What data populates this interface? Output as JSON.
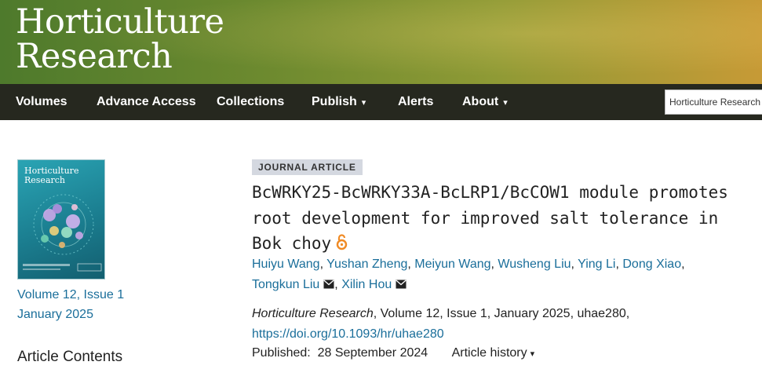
{
  "header": {
    "brand_line1": "Horticulture",
    "brand_line2": "Research"
  },
  "nav": {
    "items": [
      {
        "label": "Volumes"
      },
      {
        "label": "Advance Access"
      },
      {
        "label": "Collections"
      },
      {
        "label": "Publish"
      },
      {
        "label": "Alerts"
      },
      {
        "label": "About"
      }
    ],
    "search_label": "Horticulture Research"
  },
  "sidebar": {
    "cover_title_line1": "Horticulture",
    "cover_title_line2": "Research",
    "volume_issue": "Volume 12, Issue 1",
    "issue_date": "January 2025",
    "contents_heading": "Article Contents"
  },
  "article": {
    "type_badge": "JOURNAL ARTICLE",
    "title_line1": "BcWRKY25-BcWRKY33A-BcLRP1/BcCOW1 module promotes",
    "title_line2": "root development for improved salt tolerance in",
    "title_line3": "Bok choy",
    "authors": [
      "Huiyu Wang",
      "Yushan Zheng",
      "Meiyun Wang",
      "Wusheng Liu",
      "Ying Li",
      "Dong Xiao",
      "Tongkun Liu",
      "Xilin Hou"
    ],
    "author_sep": ",",
    "citation_journal": "Horticulture Research",
    "citation_rest": ", Volume 12, Issue 1, January 2025, uhae280,",
    "doi": "https://doi.org/10.1093/hr/uhae280",
    "published_label": "Published:",
    "published_date": "28 September 2024",
    "history_label": "Article history",
    "caret": "▾"
  },
  "colors": {
    "link": "#1a6e9a",
    "nav_bg": "#26281f",
    "badge_bg": "#d4d8e0",
    "oa_orange": "#f08a24"
  },
  "icons": {
    "open_access": "open-access-icon",
    "mail": "envelope-icon",
    "dropdown": "caret-down-icon"
  }
}
